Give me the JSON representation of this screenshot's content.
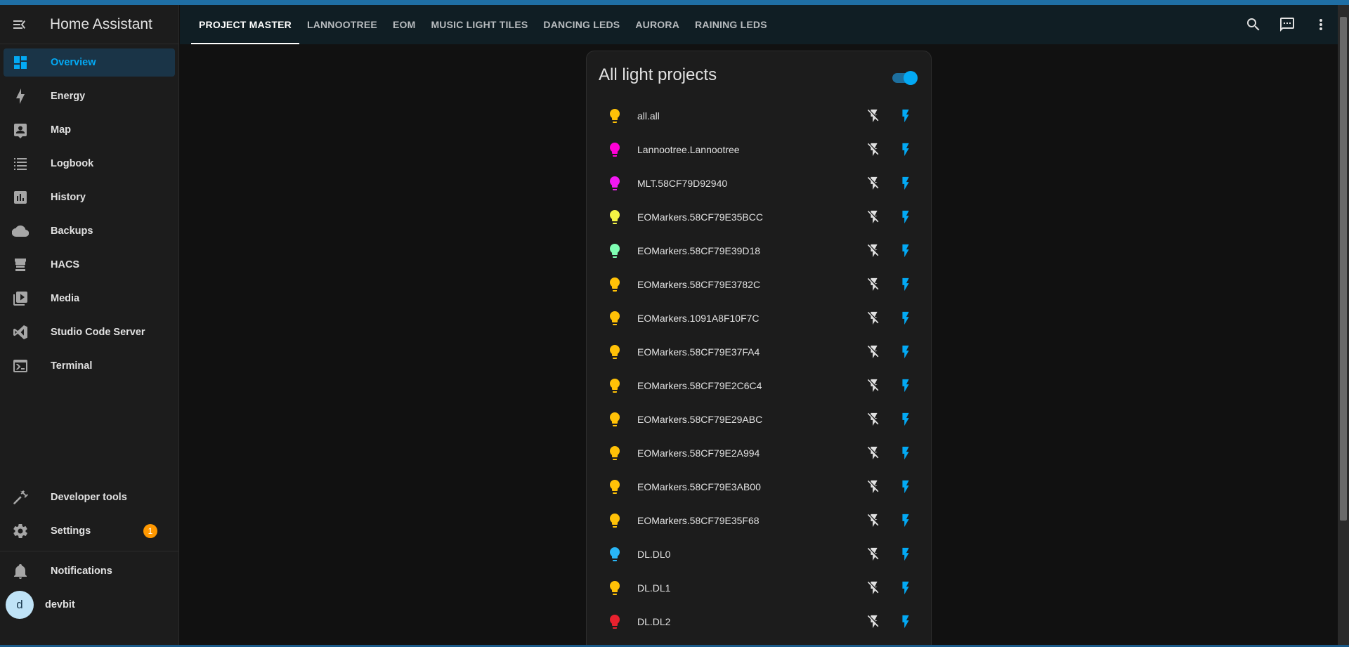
{
  "app": {
    "title": "Home Assistant"
  },
  "sidebar": {
    "items": [
      {
        "label": "Overview",
        "icon": "dashboard-icon",
        "active": true
      },
      {
        "label": "Energy",
        "icon": "lightning-icon"
      },
      {
        "label": "Map",
        "icon": "map-icon"
      },
      {
        "label": "Logbook",
        "icon": "logbook-icon"
      },
      {
        "label": "History",
        "icon": "history-icon"
      },
      {
        "label": "Backups",
        "icon": "cloud-icon"
      },
      {
        "label": "HACS",
        "icon": "hacs-icon"
      },
      {
        "label": "Media",
        "icon": "media-icon"
      },
      {
        "label": "Studio Code Server",
        "icon": "vscode-icon"
      },
      {
        "label": "Terminal",
        "icon": "terminal-icon"
      }
    ],
    "developer_tools": "Developer tools",
    "settings": "Settings",
    "settings_badge": "1",
    "notifications": "Notifications",
    "user": {
      "name": "devbit",
      "initial": "d"
    }
  },
  "tabs": [
    {
      "label": "PROJECT MASTER",
      "active": true
    },
    {
      "label": "LANNOOTREE"
    },
    {
      "label": "EOM"
    },
    {
      "label": "MUSIC LIGHT TILES"
    },
    {
      "label": "DANCING LEDS"
    },
    {
      "label": "AURORA"
    },
    {
      "label": "RAINING LEDS"
    }
  ],
  "header_icons": [
    "search-icon",
    "assist-icon",
    "more-vertical-icon"
  ],
  "card": {
    "title": "All light projects",
    "toggle_on": true,
    "entities": [
      {
        "name": "all.all",
        "color": "#ffc107"
      },
      {
        "name": "Lannootree.Lannootree",
        "color": "#ff00d6"
      },
      {
        "name": "MLT.58CF79D92940",
        "color": "#f418f4"
      },
      {
        "name": "EOMarkers.58CF79E35BCC",
        "color": "#f4f444"
      },
      {
        "name": "EOMarkers.58CF79E39D18",
        "color": "#7fffb4"
      },
      {
        "name": "EOMarkers.58CF79E3782C",
        "color": "#ffc107"
      },
      {
        "name": "EOMarkers.1091A8F10F7C",
        "color": "#ffc107"
      },
      {
        "name": "EOMarkers.58CF79E37FA4",
        "color": "#ffc107"
      },
      {
        "name": "EOMarkers.58CF79E2C6C4",
        "color": "#ffc107"
      },
      {
        "name": "EOMarkers.58CF79E29ABC",
        "color": "#ffc107"
      },
      {
        "name": "EOMarkers.58CF79E2A994",
        "color": "#ffc107"
      },
      {
        "name": "EOMarkers.58CF79E3AB00",
        "color": "#ffc107"
      },
      {
        "name": "EOMarkers.58CF79E35F68",
        "color": "#ffc107"
      },
      {
        "name": "DL.DL0",
        "color": "#29b6f6"
      },
      {
        "name": "DL.DL1",
        "color": "#ffc107"
      },
      {
        "name": "DL.DL2",
        "color": "#e8212e"
      }
    ]
  },
  "colors": {
    "accent": "#03a9f4",
    "sidebar_bg": "#1c1c1c",
    "header_bg": "#101e24",
    "badge": "#ff9800"
  }
}
